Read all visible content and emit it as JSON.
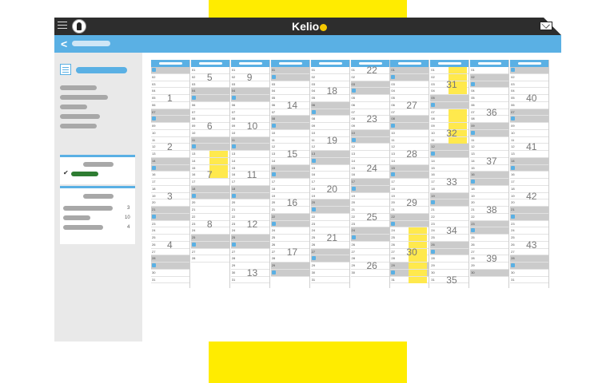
{
  "app": {
    "logo": "Kelio"
  },
  "header": {
    "back_label": "<"
  },
  "icons": {
    "menu": "hamburger-icon",
    "user": "avatar-icon",
    "mail": "mail-icon",
    "calendar": "calendar-icon",
    "check": "check-icon"
  },
  "colors": {
    "accent": "#5ab0e4",
    "topbar": "#2d2d2d",
    "highlight": "#ffe94d",
    "weekend": "#cbcbcb",
    "frame": "#ffec00",
    "selected": "#2e7d32"
  },
  "sidebar": {
    "check_mark": "✔",
    "counts": [
      "3",
      "10",
      "4"
    ]
  },
  "calendar": {
    "weeks": [
      {
        "n": "1",
        "m": 0,
        "r": 4
      },
      {
        "n": "2",
        "m": 0,
        "r": 11
      },
      {
        "n": "3",
        "m": 0,
        "r": 18
      },
      {
        "n": "4",
        "m": 0,
        "r": 25
      },
      {
        "n": "5",
        "m": 1,
        "r": 1
      },
      {
        "n": "6",
        "m": 1,
        "r": 8
      },
      {
        "n": "7",
        "m": 1,
        "r": 15
      },
      {
        "n": "8",
        "m": 1,
        "r": 22
      },
      {
        "n": "9",
        "m": 2,
        "r": 1
      },
      {
        "n": "10",
        "m": 2,
        "r": 8
      },
      {
        "n": "11",
        "m": 2,
        "r": 15
      },
      {
        "n": "12",
        "m": 2,
        "r": 22
      },
      {
        "n": "13",
        "m": 2,
        "r": 29
      },
      {
        "n": "14",
        "m": 3,
        "r": 5
      },
      {
        "n": "15",
        "m": 3,
        "r": 12
      },
      {
        "n": "16",
        "m": 3,
        "r": 19
      },
      {
        "n": "17",
        "m": 3,
        "r": 26
      },
      {
        "n": "18",
        "m": 4,
        "r": 3
      },
      {
        "n": "19",
        "m": 4,
        "r": 10
      },
      {
        "n": "20",
        "m": 4,
        "r": 17
      },
      {
        "n": "21",
        "m": 4,
        "r": 24
      },
      {
        "n": "22",
        "m": 5,
        "r": 0
      },
      {
        "n": "23",
        "m": 5,
        "r": 7
      },
      {
        "n": "24",
        "m": 5,
        "r": 14
      },
      {
        "n": "25",
        "m": 5,
        "r": 21
      },
      {
        "n": "26",
        "m": 5,
        "r": 28
      },
      {
        "n": "27",
        "m": 6,
        "r": 5
      },
      {
        "n": "28",
        "m": 6,
        "r": 12
      },
      {
        "n": "29",
        "m": 6,
        "r": 19
      },
      {
        "n": "30",
        "m": 6,
        "r": 26
      },
      {
        "n": "31",
        "m": 7,
        "r": 2
      },
      {
        "n": "32",
        "m": 7,
        "r": 9
      },
      {
        "n": "33",
        "m": 7,
        "r": 16
      },
      {
        "n": "34",
        "m": 7,
        "r": 23
      },
      {
        "n": "35",
        "m": 7,
        "r": 30
      },
      {
        "n": "36",
        "m": 8,
        "r": 6
      },
      {
        "n": "37",
        "m": 8,
        "r": 13
      },
      {
        "n": "38",
        "m": 8,
        "r": 20
      },
      {
        "n": "39",
        "m": 8,
        "r": 27
      },
      {
        "n": "40",
        "m": 9,
        "r": 4
      },
      {
        "n": "41",
        "m": 9,
        "r": 11
      },
      {
        "n": "42",
        "m": 9,
        "r": 18
      },
      {
        "n": "43",
        "m": 9,
        "r": 25
      }
    ],
    "highlights": [
      {
        "m": 1,
        "rows": [
          12,
          13,
          14,
          15
        ]
      },
      {
        "m": 6,
        "rows": [
          23,
          24,
          25,
          26,
          27,
          28,
          29,
          30
        ]
      },
      {
        "m": 7,
        "rows": [
          0,
          1,
          2,
          3,
          6,
          7,
          8,
          9,
          10
        ]
      }
    ]
  }
}
